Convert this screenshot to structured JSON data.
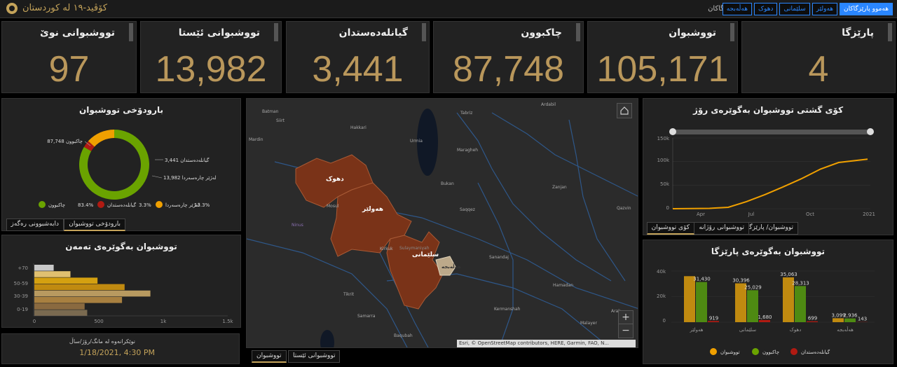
{
  "header": {
    "title": "کۆڤید-١٩ لە کوردستان",
    "region_label": "پارێزگاکان",
    "tabs": [
      "هەڵەبجە",
      "دهوک",
      "سلێمانی",
      "هەولێر",
      "هەموو پارێزگاکان"
    ],
    "active_tab": 4
  },
  "kpis": [
    {
      "label": "تووشبوانی نوێ",
      "value": "97"
    },
    {
      "label": "تووشبوانی ئێستا",
      "value": "13,982"
    },
    {
      "label": "گیانلەدەستدان",
      "value": "3,441"
    },
    {
      "label": "چاکبوون",
      "value": "87,748"
    },
    {
      "label": "تووشبوان",
      "value": "105,171"
    },
    {
      "label": "پارێزگا",
      "value": "4"
    }
  ],
  "donut": {
    "title": "بارودۆخی تووشبوان",
    "labels": {
      "recovered": "چاکبوون 87,748",
      "deaths": "گیانلەدەستدان 3,441",
      "active": "لەژێر چارەسەردا 13,982"
    },
    "legend": [
      {
        "name": "چاکبوون",
        "pct": "83.4%",
        "color": "#6aa300"
      },
      {
        "name": "گیانلەدەستدان",
        "pct": "3.3%",
        "color": "#b01a12"
      },
      {
        "name": "لەژێر چارەسەردا",
        "pct": "13.3%",
        "color": "#f0a000"
      }
    ],
    "tabs": [
      "بارودۆخی تووشبوان",
      "دابەشبوونی رەگەز"
    ]
  },
  "age": {
    "title": "تووشبوان بەگوێرەی تەمەن",
    "categories": [
      "+70",
      "50-59",
      "30-39",
      "0-19"
    ],
    "x_ticks": [
      "0",
      "500",
      "1k",
      "1.5k"
    ]
  },
  "update": {
    "label": "نوێکرانەوە لە مانگ/رۆژ/ساڵ",
    "value": "1/18/2021, 4:30 PM"
  },
  "map": {
    "attribution": "Esri, © OpenStreetMap contributors, HERE, Garmin, FAO, N...",
    "tabs": [
      "تووشبوان",
      "تووشبوانی ئێستا"
    ],
    "places": [
      {
        "name": "Tabriz"
      },
      {
        "name": "Ardabil"
      },
      {
        "name": "Urmia"
      },
      {
        "name": "Maragheh"
      },
      {
        "name": "Mosul"
      },
      {
        "name": "Ninus"
      },
      {
        "name": "Kirkuk"
      },
      {
        "name": "Saqqez"
      },
      {
        "name": "Bukan"
      },
      {
        "name": "Zanjan"
      },
      {
        "name": "Qazvin"
      },
      {
        "name": "Sanandaj"
      },
      {
        "name": "Hamadan"
      },
      {
        "name": "Kermanshah"
      },
      {
        "name": "Samarra"
      },
      {
        "name": "Tikrit"
      },
      {
        "name": "Siirt"
      },
      {
        "name": "Hakkari"
      },
      {
        "name": "Arak"
      },
      {
        "name": "Malayer"
      },
      {
        "name": "Baqubah"
      },
      {
        "name": "Batman"
      },
      {
        "name": "Mardin"
      },
      {
        "name": "Sulaymaniyah"
      }
    ],
    "regions": [
      {
        "name": "دهوک"
      },
      {
        "name": "هەولێر"
      },
      {
        "name": "سلێمانی"
      },
      {
        "name": "هەڵەبجە"
      }
    ]
  },
  "chart_data": [
    {
      "type": "pie",
      "title": "بارودۆخی تووشبوان",
      "categories": [
        "چاکبوون",
        "گیانلەدەستدان",
        "لەژێر چارەسەردا"
      ],
      "values": [
        87748,
        3441,
        13982
      ]
    },
    {
      "type": "bar",
      "title": "تووشبوان بەگوێرەی تەمەن",
      "orientation": "horizontal",
      "categories": [
        "+70",
        "",
        "50-59",
        "",
        "30-39",
        "",
        "0-19",
        ""
      ],
      "values": [
        150,
        280,
        490,
        700,
        900,
        680,
        390,
        410
      ],
      "xlim": [
        0,
        1500
      ]
    },
    {
      "type": "line",
      "title": "کۆی گشتی تووشبوان بەگوێرەی رۆژ",
      "x": [
        "2020-03-01",
        "2020-04-01",
        "2020-05-01",
        "2020-06-01",
        "2020-07-01",
        "2020-08-01",
        "2020-09-01",
        "2020-10-01",
        "2020-11-01",
        "2020-12-01",
        "2021-01-18"
      ],
      "values": [
        0,
        300,
        700,
        3000,
        15000,
        30000,
        47000,
        64000,
        84000,
        98000,
        105171
      ],
      "x_ticks": [
        "Apr",
        "Jul",
        "Oct",
        "2021"
      ],
      "y_ticks": [
        "0",
        "50k",
        "100k",
        "150k"
      ],
      "ylim": [
        0,
        150000
      ],
      "tabs": [
        "کۆی تووشبوان",
        "تووشبوانی رۆژانە",
        "تووشبوان/ پارێزگا"
      ]
    },
    {
      "type": "bar",
      "title": "تووشبوان بەگوێرەی پارێزگا",
      "categories": [
        "هەولێر",
        "سلێمانی",
        "دهوک",
        "هەڵەبجە"
      ],
      "series": [
        {
          "name": "تووشبوان",
          "values": [
            36000,
            30396,
            35063,
            3099
          ],
          "color": "#c08a10"
        },
        {
          "name": "چاکبوون",
          "values": [
            31430,
            25029,
            28313,
            2936
          ],
          "color": "#4e8a12"
        },
        {
          "name": "گیانلەدەستدان",
          "values": [
            919,
            1680,
            699,
            143
          ],
          "color": "#b01a12"
        }
      ],
      "labels": [
        [
          "",
          "31,430",
          "919"
        ],
        [
          "30,396",
          "25,029",
          "1,680"
        ],
        [
          "35,063",
          "28,313",
          "699"
        ],
        [
          "3,099",
          "2,936",
          "143"
        ]
      ],
      "y_ticks": [
        "0",
        "20k",
        "40k"
      ],
      "ylim": [
        0,
        40000
      ]
    }
  ]
}
